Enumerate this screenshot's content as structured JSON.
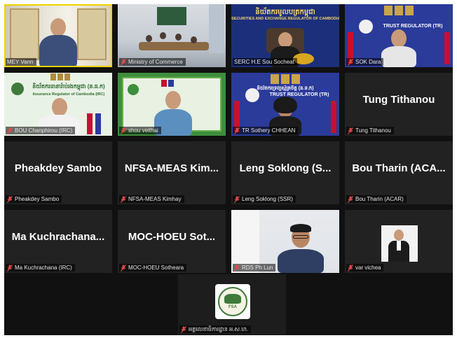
{
  "meeting": {
    "participants": [
      {
        "id": "mey",
        "label": "MEY Vann",
        "video": true
      },
      {
        "id": "moc",
        "label": "Ministry of Commerce",
        "video": true
      },
      {
        "id": "serc",
        "label": "SERC H.E Sou Socheat",
        "video": true
      },
      {
        "id": "sok",
        "label": "SOK Dara",
        "video": true
      },
      {
        "id": "bou",
        "label": "BOU Chanphirou (IRC)",
        "video": true
      },
      {
        "id": "shou",
        "label": "shou veithai",
        "video": true
      },
      {
        "id": "sothery",
        "label": "TR Sothery CHHEAN",
        "video": true
      },
      {
        "id": "tung",
        "label": "Tung Tithanou",
        "display": "Tung Tithanou",
        "video": false
      },
      {
        "id": "pheakdey",
        "label": "Pheakdey Sambo",
        "display": "Pheakdey Sambo",
        "video": false
      },
      {
        "id": "nfsa",
        "label": "NFSA-MEAS Kimhay",
        "display": "NFSA-MEAS Kim...",
        "video": false
      },
      {
        "id": "leng",
        "label": "Leng Soklong (SSR)",
        "display": "Leng Soklong (S...",
        "video": false
      },
      {
        "id": "bouth",
        "label": "Bou Tharin (ACAR)",
        "display": "Bou Tharin (ACA...",
        "video": false
      },
      {
        "id": "ma",
        "label": "Ma Kuchrachana (IRC)",
        "display": "Ma Kuchrachana...",
        "video": false
      },
      {
        "id": "mochoeu",
        "label": "MOC-HOEU Sotheara",
        "display": "MOC-HOEU Sot...",
        "video": false
      },
      {
        "id": "rds",
        "label": "RDS Ph Lun",
        "video": true
      },
      {
        "id": "var",
        "label": "var vichea",
        "video": true
      },
      {
        "id": "fsa",
        "label": "អគ្គលេខាធិការដ្ឋាន អ.ស.ហ.",
        "video": true
      }
    ]
  },
  "banners": {
    "serc_title": "និយ័តករមូលបត្រកម្ពុជា",
    "serc_subtitle": "SECURITIES AND EXCHANGE REGULATOR OF CAMBODIA",
    "trust_text": "TRUST REGULATOR (TR)",
    "irc_title": "និយ័តករធានារ៉ាប់រងកម្ពុជា (ន.ធ.ក)",
    "irc_subtitle": "Insurance Regulator of Cambodia (IRC)",
    "trust_title": "និយ័តករ​ទ្រព្យ​ស្ម័គ្រ​ចិត្ត (ន.ទ.ក)",
    "fsa_logo_text": "FSA"
  },
  "colors": {
    "serc_blue": "#1c2f7a",
    "trust_blue": "#2b3b9a",
    "irc_green": "#e9f2e6",
    "fsa_green": "#3f7a3a",
    "speaker_border": "#f2d200"
  }
}
